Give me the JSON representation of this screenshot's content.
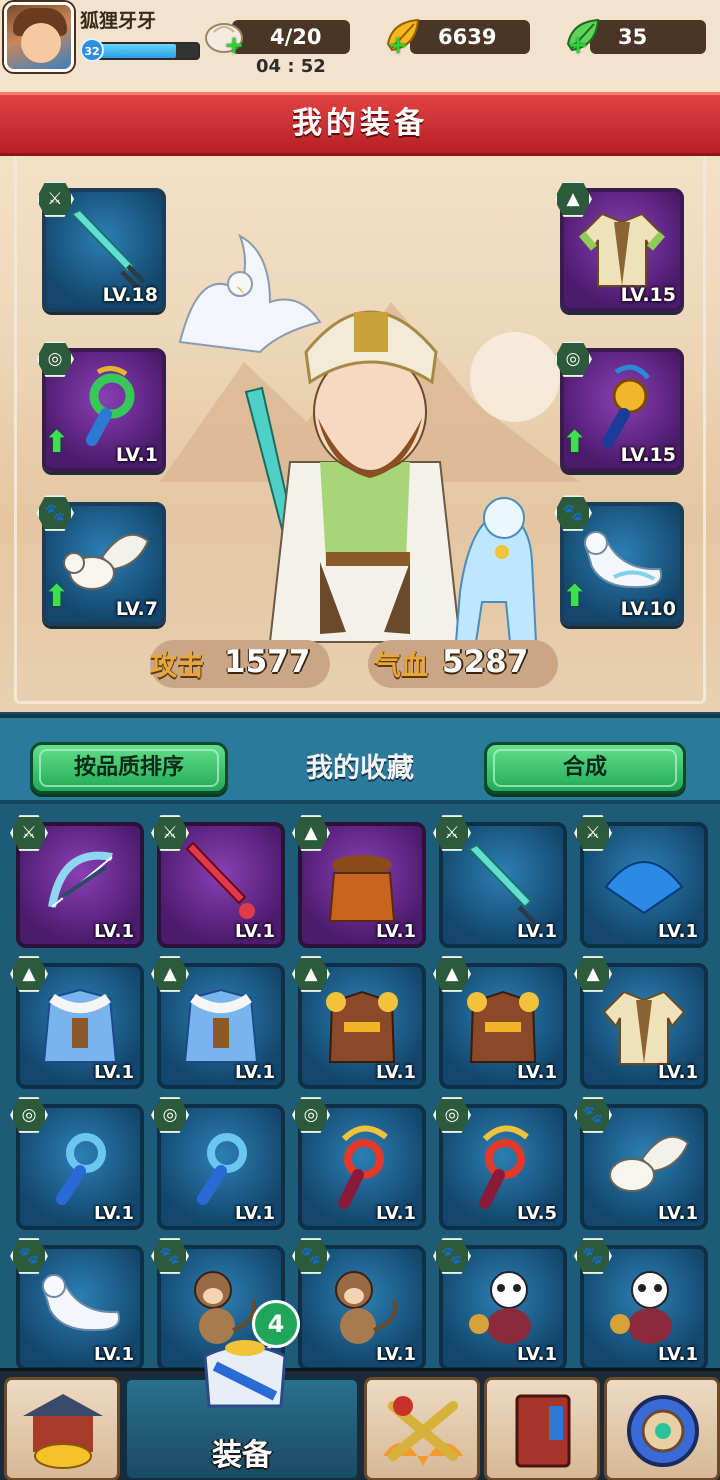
{
  "player": {
    "name": "狐狸牙牙",
    "level": "32",
    "xp_fraction": 0.78
  },
  "resources": {
    "stamina": {
      "value": "4/20",
      "icon": "bun-icon"
    },
    "gold": {
      "value": "6639",
      "icon": "gold-leaf-icon"
    },
    "gems": {
      "value": "35",
      "icon": "green-leaf-icon"
    },
    "timer": "04 : 52"
  },
  "equipment": {
    "title": "我的装备",
    "slots": [
      {
        "name": "weapon-slot",
        "type": "sword-icon",
        "level": "LV.18",
        "rarity": "blue"
      },
      {
        "name": "armor-slot",
        "type": "robe-icon",
        "level": "LV.15",
        "rarity": "purple"
      },
      {
        "name": "accessory-slot-left",
        "type": "jade-pendant-icon",
        "level": "LV.1",
        "rarity": "purple",
        "upgrade": true
      },
      {
        "name": "accessory-slot-right",
        "type": "dragon-pendant-icon",
        "level": "LV.15",
        "rarity": "purple",
        "upgrade": true
      },
      {
        "name": "pet-slot-left",
        "type": "squirrel-icon",
        "level": "LV.7",
        "rarity": "blue",
        "upgrade": true
      },
      {
        "name": "pet-slot-right",
        "type": "ferret-icon",
        "level": "LV.10",
        "rarity": "blue",
        "upgrade": true
      }
    ],
    "stats": {
      "attack_label": "攻击",
      "attack_value": "1577",
      "hp_label": "气血",
      "hp_value": "5287"
    }
  },
  "collection": {
    "title": "我的收藏",
    "sort_button": "按品质排序",
    "combine_button": "合成",
    "items": [
      {
        "icon": "bow-icon",
        "level": "LV.1",
        "rarity": "purple",
        "kind": "weapon"
      },
      {
        "icon": "red-sword-icon",
        "level": "LV.1",
        "rarity": "purple",
        "kind": "weapon"
      },
      {
        "icon": "hat-armor-icon",
        "level": "LV.1",
        "rarity": "purple",
        "kind": "armor"
      },
      {
        "icon": "sword-icon",
        "level": "LV.1",
        "rarity": "blue",
        "kind": "weapon"
      },
      {
        "icon": "fan-icon",
        "level": "LV.1",
        "rarity": "blue",
        "kind": "weapon"
      },
      {
        "icon": "fur-coat-icon",
        "level": "LV.1",
        "rarity": "blue",
        "kind": "armor"
      },
      {
        "icon": "fur-coat-icon",
        "level": "LV.1",
        "rarity": "blue",
        "kind": "armor"
      },
      {
        "icon": "gold-armor-icon",
        "level": "LV.1",
        "rarity": "blue",
        "kind": "armor"
      },
      {
        "icon": "gold-armor-icon",
        "level": "LV.1",
        "rarity": "blue",
        "kind": "armor"
      },
      {
        "icon": "robe-icon",
        "level": "LV.1",
        "rarity": "blue",
        "kind": "armor"
      },
      {
        "icon": "blue-pendant-icon",
        "level": "LV.1",
        "rarity": "blue",
        "kind": "accessory"
      },
      {
        "icon": "blue-pendant-icon",
        "level": "LV.1",
        "rarity": "blue",
        "kind": "accessory"
      },
      {
        "icon": "phoenix-pendant-icon",
        "level": "LV.1",
        "rarity": "blue",
        "kind": "accessory"
      },
      {
        "icon": "phoenix-pendant-icon",
        "level": "LV.5",
        "rarity": "blue",
        "kind": "accessory"
      },
      {
        "icon": "squirrel-icon",
        "level": "LV.1",
        "rarity": "blue",
        "kind": "pet"
      },
      {
        "icon": "ferret-icon",
        "level": "LV.1",
        "rarity": "blue",
        "kind": "pet"
      },
      {
        "icon": "monkey-icon",
        "level": "LV.1",
        "rarity": "blue",
        "kind": "pet"
      },
      {
        "icon": "monkey-icon",
        "level": "LV.1",
        "rarity": "blue",
        "kind": "pet"
      },
      {
        "icon": "panda-icon",
        "level": "LV.1",
        "rarity": "blue",
        "kind": "pet"
      },
      {
        "icon": "panda-icon",
        "level": "LV.1",
        "rarity": "blue",
        "kind": "pet"
      }
    ]
  },
  "nav": {
    "items": [
      {
        "icon": "shop-icon"
      },
      {
        "icon": "equipment-icon",
        "label": "装备",
        "badge": "4",
        "active": true
      },
      {
        "icon": "battle-icon"
      },
      {
        "icon": "book-icon"
      },
      {
        "icon": "settings-icon"
      }
    ]
  },
  "colors": {
    "banner": "#c82a2e",
    "rarity_blue": "#1b5d8a",
    "rarity_purple": "#6a2b93",
    "button_green": "#3ec46e"
  }
}
